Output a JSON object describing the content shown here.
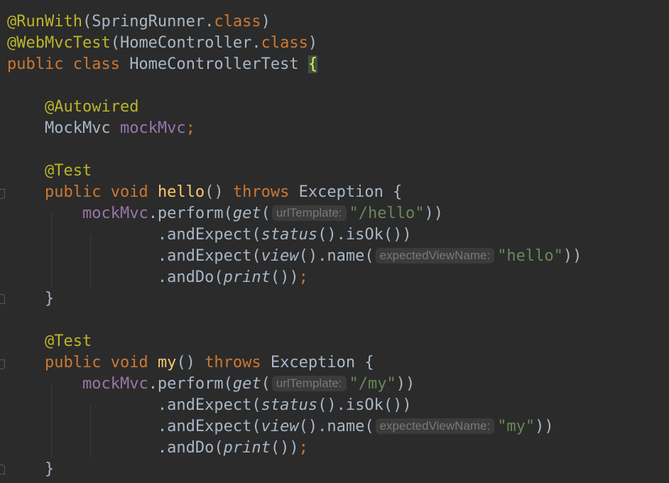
{
  "editor": {
    "lines": [
      [
        {
          "t": "@RunWith",
          "c": "ann"
        },
        {
          "t": "(SpringRunner.",
          "c": "txt"
        },
        {
          "t": "class",
          "c": "kw"
        },
        {
          "t": ")",
          "c": "txt"
        }
      ],
      [
        {
          "t": "@WebMvcTest",
          "c": "ann"
        },
        {
          "t": "(HomeController.",
          "c": "txt"
        },
        {
          "t": "class",
          "c": "kw"
        },
        {
          "t": ")",
          "c": "txt"
        }
      ],
      [
        {
          "t": "public class ",
          "c": "kw"
        },
        {
          "t": "HomeControllerTest ",
          "c": "cls"
        },
        {
          "t": "{",
          "c": "brace-hl"
        }
      ],
      [],
      [
        {
          "t": "    "
        },
        {
          "t": "@Autowired",
          "c": "ann"
        }
      ],
      [
        {
          "t": "    "
        },
        {
          "t": "MockMvc ",
          "c": "txt"
        },
        {
          "t": "mockMvc",
          "c": "fld"
        },
        {
          "t": ";",
          "c": "kw"
        }
      ],
      [],
      [
        {
          "t": "    "
        },
        {
          "t": "@Test",
          "c": "ann"
        }
      ],
      [
        {
          "t": "    "
        },
        {
          "t": "public void ",
          "c": "kw"
        },
        {
          "t": "hello",
          "c": "mth"
        },
        {
          "t": "() ",
          "c": "txt"
        },
        {
          "t": "throws ",
          "c": "kw"
        },
        {
          "t": "Exception {",
          "c": "txt"
        }
      ],
      [
        {
          "t": "        "
        },
        {
          "t": "mockMvc",
          "c": "fld"
        },
        {
          "t": ".perform(",
          "c": "txt"
        },
        {
          "t": "get",
          "c": "txt it"
        },
        {
          "t": "(",
          "c": "txt"
        },
        {
          "hint": "urlTemplate:"
        },
        {
          "t": "\"/hello\"",
          "c": "str"
        },
        {
          "t": "))",
          "c": "txt"
        }
      ],
      [
        {
          "t": "                "
        },
        {
          "t": ".andExpect(",
          "c": "txt"
        },
        {
          "t": "status",
          "c": "txt it"
        },
        {
          "t": "().isOk())",
          "c": "txt"
        }
      ],
      [
        {
          "t": "                "
        },
        {
          "t": ".andExpect(",
          "c": "txt"
        },
        {
          "t": "view",
          "c": "txt it"
        },
        {
          "t": "().name(",
          "c": "txt"
        },
        {
          "hint": "expectedViewName:"
        },
        {
          "t": "\"hello\"",
          "c": "str"
        },
        {
          "t": "))",
          "c": "txt"
        }
      ],
      [
        {
          "t": "                "
        },
        {
          "t": ".andDo(",
          "c": "txt"
        },
        {
          "t": "print",
          "c": "txt it"
        },
        {
          "t": "())",
          "c": "txt"
        },
        {
          "t": ";",
          "c": "kw"
        }
      ],
      [
        {
          "t": "    "
        },
        {
          "t": "}",
          "c": "txt"
        }
      ],
      [],
      [
        {
          "t": "    "
        },
        {
          "t": "@Test",
          "c": "ann"
        }
      ],
      [
        {
          "t": "    "
        },
        {
          "t": "public void ",
          "c": "kw"
        },
        {
          "t": "my",
          "c": "mth"
        },
        {
          "t": "() ",
          "c": "txt"
        },
        {
          "t": "throws ",
          "c": "kw"
        },
        {
          "t": "Exception {",
          "c": "txt"
        }
      ],
      [
        {
          "t": "        "
        },
        {
          "t": "mockMvc",
          "c": "fld"
        },
        {
          "t": ".perform(",
          "c": "txt"
        },
        {
          "t": "get",
          "c": "txt it"
        },
        {
          "t": "(",
          "c": "txt"
        },
        {
          "hint": "urlTemplate:"
        },
        {
          "t": "\"/my\"",
          "c": "str"
        },
        {
          "t": "))",
          "c": "txt"
        }
      ],
      [
        {
          "t": "                "
        },
        {
          "t": ".andExpect(",
          "c": "txt"
        },
        {
          "t": "status",
          "c": "txt it"
        },
        {
          "t": "().isOk())",
          "c": "txt"
        }
      ],
      [
        {
          "t": "                "
        },
        {
          "t": ".andExpect(",
          "c": "txt"
        },
        {
          "t": "view",
          "c": "txt it"
        },
        {
          "t": "().name(",
          "c": "txt"
        },
        {
          "hint": "expectedViewName:"
        },
        {
          "t": "\"my\"",
          "c": "str"
        },
        {
          "t": "))",
          "c": "txt"
        }
      ],
      [
        {
          "t": "                "
        },
        {
          "t": ".andDo(",
          "c": "txt"
        },
        {
          "t": "print",
          "c": "txt it"
        },
        {
          "t": "())",
          "c": "txt"
        },
        {
          "t": ";",
          "c": "kw"
        }
      ],
      [
        {
          "t": "    "
        },
        {
          "t": "}",
          "c": "txt"
        }
      ]
    ]
  },
  "colors": {
    "background": "#2b2b2b",
    "annotation": "#bbb529",
    "keyword": "#cc7832",
    "field": "#9876aa",
    "method": "#ffc66d",
    "string": "#6a8759",
    "text": "#a9b7c6"
  },
  "gutter_icons": [
    "fold-open-icon",
    "fold-close-icon"
  ]
}
